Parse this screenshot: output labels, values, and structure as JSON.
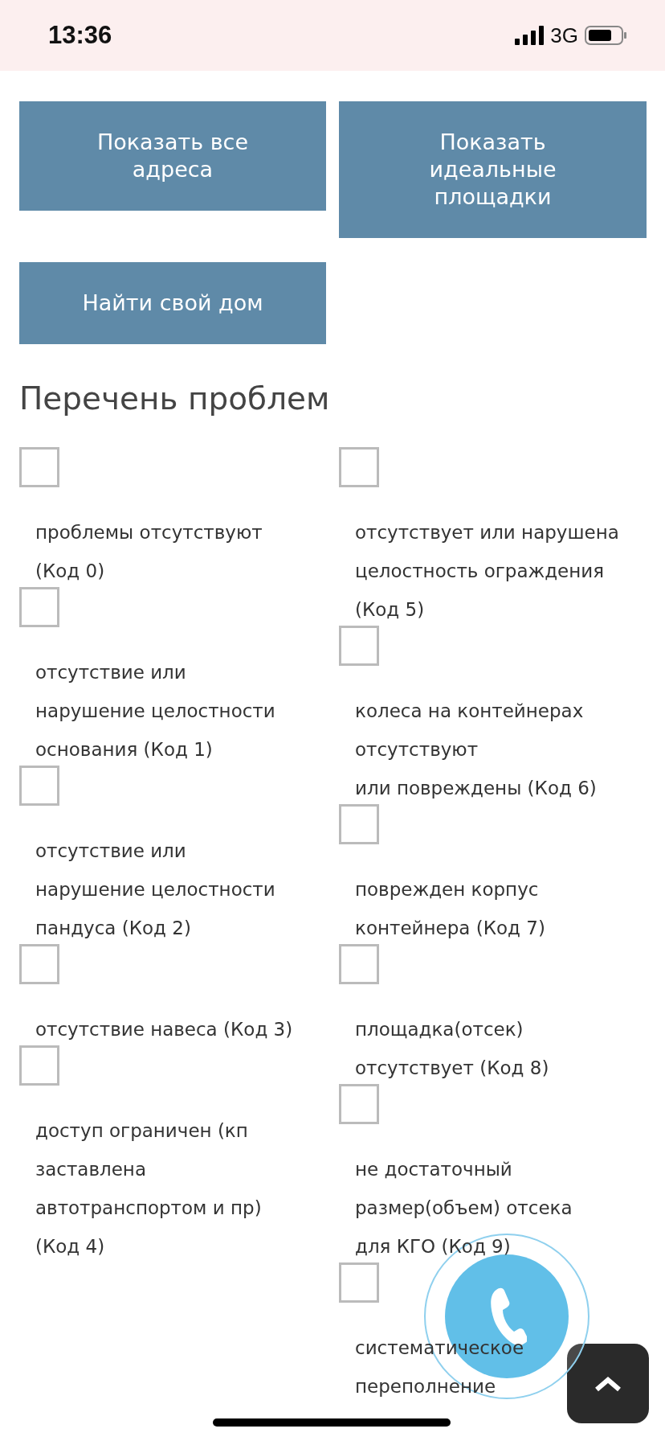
{
  "status_bar": {
    "time": "13:36",
    "network": "3G"
  },
  "buttons": [
    {
      "label": "Показать все адреса"
    },
    {
      "label": "Показать идеальные площадки"
    },
    {
      "label": "Найти свой дом"
    }
  ],
  "heading": "Перечень проблем",
  "problem_columns": [
    {
      "items": [
        {
          "label": "проблемы отсутствуют\n(Код 0)",
          "checked": false
        },
        {
          "label": "отсутствие или\nнарушение целостности\nоснования (Код 1)",
          "checked": false
        },
        {
          "label": "отсутствие или\nнарушение целостности\nпандуса (Код 2)",
          "checked": false
        },
        {
          "label": "отсутствие навеса (Код 3)",
          "checked": false
        },
        {
          "label": "доступ ограничен (кп\nзаставлена\nавтотранспортом и пр)\n(Код 4)",
          "checked": false
        }
      ]
    },
    {
      "items": [
        {
          "label": "отсутствует или нарушена\nцелостность ограждения\n(Код 5)",
          "checked": false
        },
        {
          "label": "колеса на контейнерах\nотсутствуют\nили повреждены (Код 6)",
          "checked": false
        },
        {
          "label": "поврежден корпус\nконтейнера (Код 7)",
          "checked": false
        },
        {
          "label": "площадка(отсек)\nотсутствует (Код 8)",
          "checked": false
        },
        {
          "label": "не достаточный\nразмер(объем) отсека\nдля КГО (Код 9)",
          "checked": false
        },
        {
          "label": "систематическое\nпереполнение",
          "checked": false
        }
      ]
    }
  ]
}
